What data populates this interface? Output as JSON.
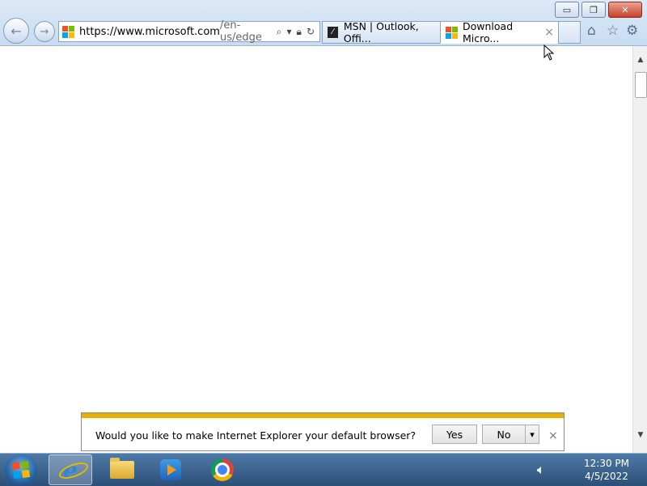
{
  "browser": {
    "address": {
      "host": "https://www.microsoft.com",
      "path": "/en-us/edge"
    },
    "tabs": [
      {
        "label": "MSN | Outlook, Offi...",
        "active": false
      },
      {
        "label": "Download Micro...",
        "active": true,
        "close": "×"
      }
    ],
    "window_buttons": {
      "minimize": "▭",
      "restore": "❐",
      "close": "✕"
    },
    "toolbar_icons": [
      "home-icon",
      "favorites-star-icon",
      "settings-gear-icon"
    ]
  },
  "notification": {
    "message": "Would you like to make Internet Explorer your default browser?",
    "yes_label": "Yes",
    "no_label": "No",
    "dropdown": "▾",
    "close": "×"
  },
  "taskbar": {
    "apps": [
      "internet-explorer",
      "file-explorer",
      "media-player",
      "chrome"
    ],
    "clock": {
      "time": "12:30 PM",
      "date": "4/5/2022"
    }
  },
  "colors": {
    "notification_strip": "#e8b000",
    "titlebar": "#dce9f7",
    "taskbar": "#2b4f78"
  }
}
